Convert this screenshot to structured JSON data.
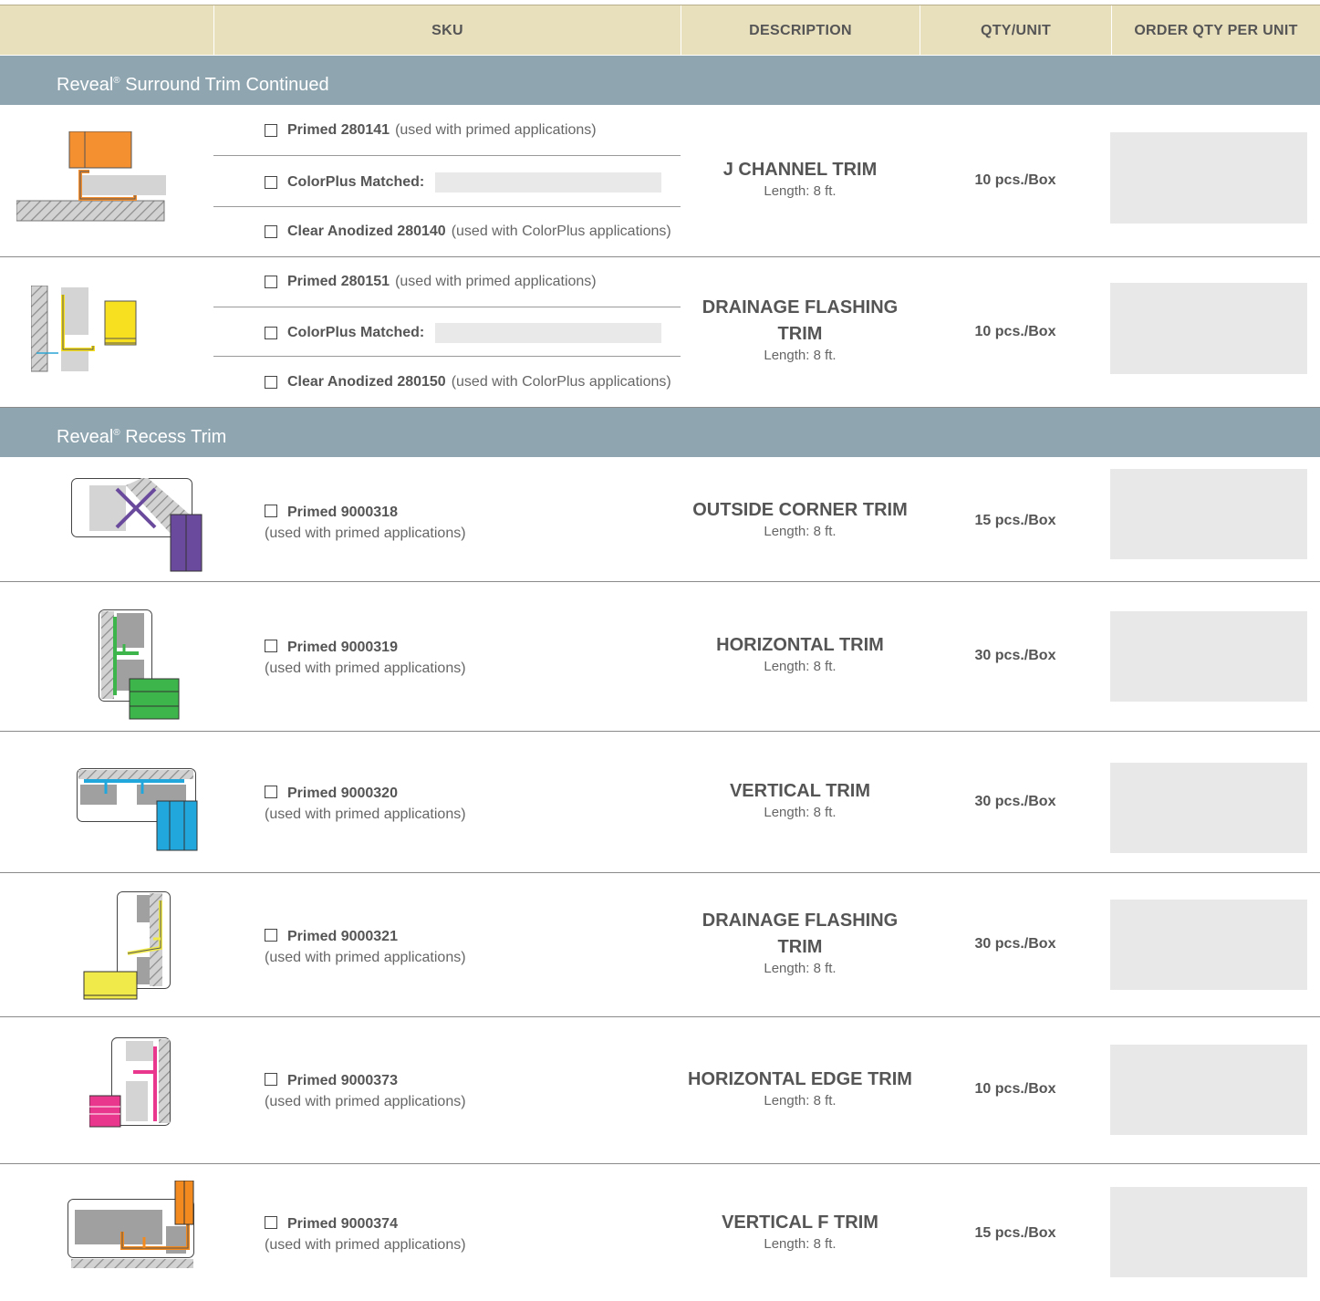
{
  "header": {
    "sku": "SKU",
    "description": "DESCRIPTION",
    "qty_unit": "QTY/UNIT",
    "order_qty": "ORDER QTY PER UNIT"
  },
  "sections": [
    {
      "name": "Reveal",
      "mark": "®",
      "suffix": "Surround Trim Continued"
    },
    {
      "name": "Reveal",
      "mark": "®",
      "suffix": "Recess Trim"
    }
  ],
  "surround_rows": [
    {
      "options": [
        {
          "bold": "Primed 280141",
          "note": "(used with primed applications)"
        },
        {
          "bold": "ColorPlus Matched:",
          "note": ""
        },
        {
          "bold": "Clear Anodized 280140",
          "note": "(used with ColorPlus applications)"
        }
      ],
      "title": "J CHANNEL TRIM",
      "length": "Length: 8 ft.",
      "qty": "10 pcs./Box",
      "icon": "j-channel-trim-icon",
      "color": "#f4902f"
    },
    {
      "options": [
        {
          "bold": "Primed 280151",
          "note": "(used with primed applications)"
        },
        {
          "bold": "ColorPlus Matched:",
          "note": ""
        },
        {
          "bold": "Clear Anodized 280150",
          "note": "(used with ColorPlus applications)"
        }
      ],
      "title_line1": "DRAINAGE FLASHING",
      "title_line2": "TRIM",
      "length": "Length: 8 ft.",
      "qty": "10 pcs./Box",
      "icon": "drainage-flashing-trim-icon",
      "color": "#f6e020"
    }
  ],
  "recess_rows": [
    {
      "bold": "Primed 9000318",
      "note": "(used with primed applications)",
      "title": "OUTSIDE CORNER TRIM",
      "length": "Length: 8 ft.",
      "qty": "15 pcs./Box",
      "icon": "outside-corner-trim-icon",
      "color": "#6a4a9c"
    },
    {
      "bold": "Primed 9000319",
      "note": "(used with primed applications)",
      "title": "HORIZONTAL TRIM",
      "length": "Length: 8 ft.",
      "qty": "30 pcs./Box",
      "icon": "horizontal-trim-icon",
      "color": "#3db54a"
    },
    {
      "bold": "Primed 9000320",
      "note": "(used with primed applications)",
      "title": "VERTICAL TRIM",
      "length": "Length: 8 ft.",
      "qty": "30 pcs./Box",
      "icon": "vertical-trim-icon",
      "color": "#22a7dd"
    },
    {
      "bold": "Primed 9000321",
      "note": "(used with primed applications)",
      "title_line1": "DRAINAGE FLASHING",
      "title_line2": "TRIM",
      "length": "Length: 8 ft.",
      "qty": "30 pcs./Box",
      "icon": "drainage-flashing-trim-icon",
      "color": "#f0ea4a"
    },
    {
      "bold": "Primed 9000373",
      "note": "(used with primed applications)",
      "title": "HORIZONTAL EDGE TRIM",
      "length": "Length: 8 ft.",
      "qty": "10 pcs./Box",
      "icon": "horizontal-edge-trim-icon",
      "color": "#e8378c"
    },
    {
      "bold": "Primed 9000374",
      "note": "(used with primed applications)",
      "title": "VERTICAL F TRIM",
      "length": "Length: 8 ft.",
      "qty": "15 pcs./Box",
      "icon": "vertical-f-trim-icon",
      "color": "#f28a20"
    }
  ]
}
